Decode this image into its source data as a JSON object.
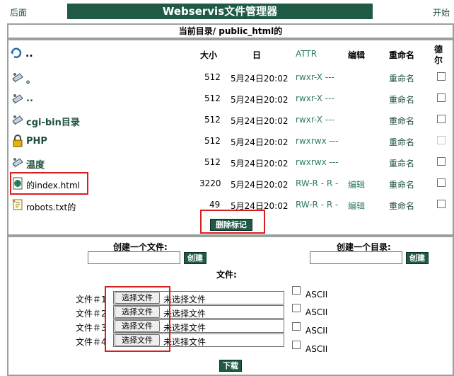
{
  "top": {
    "left_link": "后面",
    "title": "Webservis文件管理器",
    "right_link": "开始"
  },
  "path_bar": {
    "label": "当前目录/ public_html的"
  },
  "columns": {
    "size": "大小",
    "date": "日",
    "attr": "ATTR",
    "edit": "编辑",
    "rename": "重命名",
    "delete_1": "德",
    "delete_2": "尔"
  },
  "up_row": {
    "name": ".."
  },
  "files": [
    {
      "icon": "folder-icon",
      "name": "。",
      "size": "512",
      "date": "5月24日20:02",
      "attr": "rwxr-X ---",
      "edit": "",
      "rename": "重命名",
      "disabled": false
    },
    {
      "icon": "folder-icon",
      "name": "..",
      "size": "512",
      "date": "5月24日20:02",
      "attr": "rwxr-X ---",
      "edit": "",
      "rename": "重命名",
      "disabled": false
    },
    {
      "icon": "folder-icon",
      "name": "cgi-bin目录",
      "size": "512",
      "date": "5月24日20:02",
      "attr": "rwxr-X ---",
      "edit": "",
      "rename": "重命名",
      "disabled": false
    },
    {
      "icon": "lock-icon",
      "name": "PHP",
      "size": "512",
      "date": "5月24日20:02",
      "attr": "rwxrwx ---",
      "edit": "",
      "rename": "重命名",
      "disabled": true
    },
    {
      "icon": "folder-icon",
      "name": "温度",
      "size": "512",
      "date": "5月24日20:02",
      "attr": "rwxrwx ---",
      "edit": "",
      "rename": "重命名",
      "disabled": false
    },
    {
      "icon": "globe-page-icon",
      "name": "的index.html",
      "size": "3220",
      "date": "5月24日20:02",
      "attr": "RW-R - R -",
      "edit": "编辑",
      "rename": "重命名",
      "disabled": false
    },
    {
      "icon": "text-file-icon",
      "name": "robots.txt的",
      "size": "49",
      "date": "5月24日20:02",
      "attr": "RW-R - R -",
      "edit": "编辑",
      "rename": "重命名",
      "disabled": false
    }
  ],
  "delete_marked": "删除标记",
  "create_file": {
    "label": "创建一个文件:",
    "button": "创建",
    "value": ""
  },
  "create_dir": {
    "label": "创建一个目录:",
    "button": "创建",
    "value": ""
  },
  "upload": {
    "label": "文件:",
    "rows": [
      {
        "label": "文件＃1",
        "button": "选择文件",
        "status": "未选择文件",
        "ascii": "ASCII"
      },
      {
        "label": "文件＃2",
        "button": "选择文件",
        "status": "未选择文件",
        "ascii": "ASCII"
      },
      {
        "label": "文件＃3",
        "button": "选择文件",
        "status": "未选择文件",
        "ascii": "ASCII"
      },
      {
        "label": "文件＃4",
        "button": "选择文件",
        "status": "未选择文件",
        "ascii": "ASCII"
      }
    ],
    "submit": "下载"
  },
  "colors": {
    "banner": "#1f5a45",
    "highlight": "#d62020",
    "perm_text": "#2e7b5c"
  }
}
